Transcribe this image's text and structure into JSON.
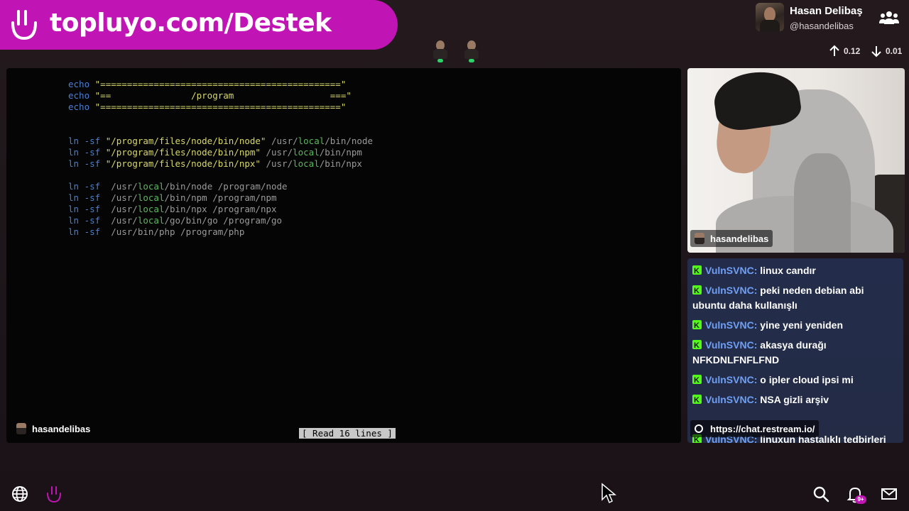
{
  "banner": {
    "text": "topluyo.com/Destek"
  },
  "profile": {
    "name": "Hasan Delibaş",
    "handle": "@hasandelibas"
  },
  "network": {
    "upload": "0.12",
    "download": "0.01"
  },
  "terminal": {
    "echo_lines": [
      {
        "cmd": "echo",
        "arg": "\"=============================================\""
      },
      {
        "cmd": "echo",
        "arg": "\"==               /program                  ===\""
      },
      {
        "cmd": "echo",
        "arg": "\"=============================================\""
      }
    ],
    "link_lines_a": [
      {
        "cmd": "ln -sf",
        "src": "\"/program/files/node/bin/node\"",
        "dst_pre": " /usr/",
        "dst_local": "local",
        "dst_post": "/bin/node"
      },
      {
        "cmd": "ln -sf",
        "src": "\"/program/files/node/bin/npm\"",
        "dst_pre": " /usr/",
        "dst_local": "local",
        "dst_post": "/bin/npm"
      },
      {
        "cmd": "ln -sf",
        "src": "\"/program/files/node/bin/npx\"",
        "dst_pre": " /usr/",
        "dst_local": "local",
        "dst_post": "/bin/npx"
      }
    ],
    "link_lines_b": [
      {
        "cmd": "ln -sf",
        "pre": "  /usr/",
        "local": "local",
        "post": "/bin/node /program/node"
      },
      {
        "cmd": "ln -sf",
        "pre": "  /usr/",
        "local": "local",
        "post": "/bin/npm /program/npm"
      },
      {
        "cmd": "ln -sf",
        "pre": "  /usr/",
        "local": "local",
        "post": "/bin/npx /program/npx"
      },
      {
        "cmd": "ln -sf",
        "pre": "  /usr/",
        "local": "local",
        "post": "/go/bin/go /program/go"
      },
      {
        "cmd": "ln -sf",
        "pre": "  /usr/bin/php /program/php",
        "local": "",
        "post": ""
      }
    ],
    "status": "[ Read 16 lines ]",
    "cam_label": "hasandelibas"
  },
  "webcam": {
    "label": "hasandelibas"
  },
  "chat": {
    "messages": [
      {
        "user": "VulnSVNC",
        "text": "linux candır"
      },
      {
        "user": "VulnSVNC",
        "text": "peki neden debian abi ubuntu daha kullanışlı"
      },
      {
        "user": "VulnSVNC",
        "text": "yine yeni yeniden"
      },
      {
        "user": "VulnSVNC",
        "text": "akasya durağı NFKDNLFNFLFND"
      },
      {
        "user": "VulnSVNC",
        "text": "o ipler cloud ipsi mi"
      },
      {
        "user": "VulnSVNC",
        "text": "NSA gizli arşiv"
      },
      {
        "user": "VulnSVNC",
        "text": "linuxun hastalıklı tedbirleri"
      }
    ],
    "restream_url": "https://chat.restream.io/"
  },
  "bottom_bar": {
    "notifications_badge": "9+"
  },
  "colors": {
    "brand": "#c014b4",
    "chat_bg": "#232c4a",
    "username": "#6fa0f6",
    "kick": "#53fc18"
  }
}
